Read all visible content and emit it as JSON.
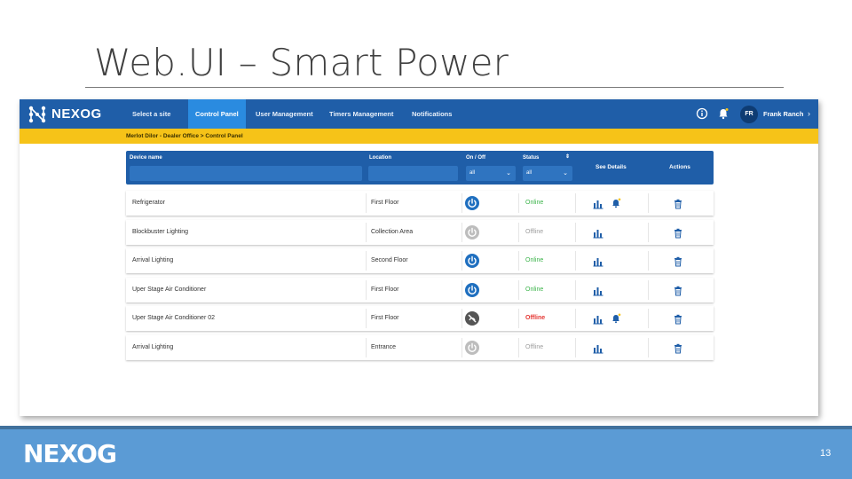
{
  "slide": {
    "title": "Web.UI – Smart Power",
    "page_number": "13",
    "footer_logo": "NEXOG"
  },
  "app": {
    "brand": "NEXOG",
    "nav": [
      "Select a site",
      "Control Panel",
      "User Management",
      "Timers Management",
      "Notifications"
    ],
    "active_nav": "Control Panel",
    "user": {
      "initials": "FR",
      "name": "Frank Ranch"
    },
    "breadcrumb": "Merlot Dilor - Dealer Office  >  Control Panel"
  },
  "filters": {
    "device_label": "Device name",
    "location_label": "Location",
    "onoff_label": "On / Off",
    "status_label": "Status",
    "onoff_value": "all",
    "status_value": "all",
    "see_details": "See Details",
    "actions": "Actions"
  },
  "colors": {
    "online": "#3cb44b",
    "offline": "#9e9e9e",
    "offline_alert": "#e53935",
    "power_on": "#1f6fbf",
    "power_off": "#bdbdbd",
    "power_fault": "#555555",
    "nav_bg": "#1f5ea8",
    "breadcrumb_bg": "#f6c318"
  },
  "devices": [
    {
      "name": "Refrigerator",
      "location": "First Floor",
      "power": "on",
      "status": "Online",
      "status_kind": "online",
      "alert": true
    },
    {
      "name": "Blockbuster Lighting",
      "location": "Collection Area",
      "power": "off",
      "status": "Offline",
      "status_kind": "offline",
      "alert": false
    },
    {
      "name": "Arrival Lighting",
      "location": "Second Floor",
      "power": "on",
      "status": "Online",
      "status_kind": "online",
      "alert": false
    },
    {
      "name": "Uper Stage Air Conditioner",
      "location": "First Floor",
      "power": "on",
      "status": "Online",
      "status_kind": "online",
      "alert": false
    },
    {
      "name": "Uper Stage Air Conditioner 02",
      "location": "First Floor",
      "power": "fault",
      "status": "Offline",
      "status_kind": "offline_alert",
      "alert": true
    },
    {
      "name": "Arrival Lighting",
      "location": "Entrance",
      "power": "off",
      "status": "Offline",
      "status_kind": "offline",
      "alert": false
    }
  ]
}
